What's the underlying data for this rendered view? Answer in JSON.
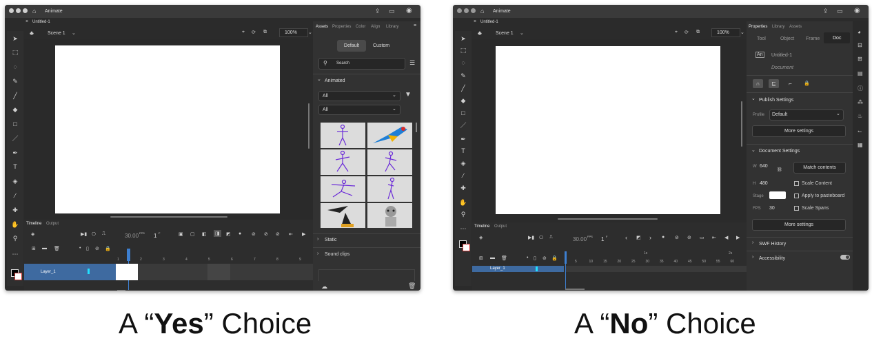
{
  "left": {
    "app_title": "Animate",
    "doc_tab": "Untitled-1",
    "scene": "Scene 1",
    "zoom": "100%",
    "panel_tabs": [
      "Assets",
      "Properties",
      "Color",
      "Align",
      "Library"
    ],
    "toggle": [
      "Default",
      "Custom"
    ],
    "search_placeholder": "Search",
    "section_animated": "Animated",
    "filter1": "All",
    "filter2": "All",
    "section_static": "Static",
    "section_sound": "Sound clips",
    "timeline_tabs": [
      "Timeline",
      "Output"
    ],
    "fps": "30.00",
    "fps_unit": "FPS",
    "frame": "1",
    "frame_unit": "F",
    "layer_name": "Layer_1",
    "frame_numbers": [
      "1",
      "2",
      "3",
      "4",
      "5",
      "6",
      "7",
      "8",
      "9"
    ]
  },
  "right": {
    "app_title": "Animate",
    "doc_tab": "Untitled-1",
    "scene": "Scene 1",
    "zoom": "100%",
    "panel_tabs": [
      "Properties",
      "Library",
      "Assets"
    ],
    "prop_tabs": [
      "Tool",
      "Object",
      "Frame",
      "Doc"
    ],
    "doc_name": "Untitled-1",
    "doc_label": "Document",
    "publish_settings": "Publish Settings",
    "profile_label": "Profile",
    "profile_value": "Default",
    "more_settings_1": "More settings",
    "document_settings": "Document Settings",
    "w_label": "W",
    "w_value": "640",
    "h_label": "H",
    "h_value": "480",
    "match_contents": "Match contents",
    "scale_content": "Scale Content",
    "stage_label": "Stage",
    "apply_pasteboard": "Apply to pasteboard",
    "fps_label": "FPS",
    "fps_value": "30",
    "scale_spans": "Scale Spans",
    "more_settings_2": "More settings",
    "swf_history": "SWF History",
    "accessibility": "Accessibility",
    "timeline_tabs": [
      "Timeline",
      "Output"
    ],
    "fps": "30.00",
    "fps_unit": "FPS",
    "frame": "1",
    "frame_unit": "F",
    "layer_name": "Layer_1",
    "frame_numbers": [
      "5",
      "10",
      "15",
      "20",
      "25",
      "30",
      "35",
      "40",
      "45",
      "50",
      "55",
      "60"
    ],
    "second_markers": [
      "1s",
      "2s"
    ]
  },
  "captions": {
    "yes_prefix": "A “",
    "yes_word": "Yes",
    "yes_suffix": "” Choice",
    "no_prefix": "A “",
    "no_word": "No",
    "no_suffix": "” Choice"
  }
}
